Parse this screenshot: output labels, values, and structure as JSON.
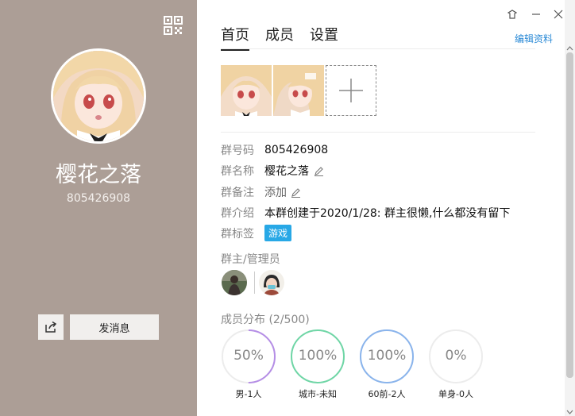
{
  "profile": {
    "name": "樱花之落",
    "id": "805426908",
    "send_label": "发消息"
  },
  "tabs": [
    {
      "label": "首页",
      "active": true
    },
    {
      "label": "成员",
      "active": false
    },
    {
      "label": "设置",
      "active": false
    }
  ],
  "edit_label": "编辑资料",
  "info": {
    "id_label": "群号码",
    "id_value": "805426908",
    "name_label": "群名称",
    "name_value": "樱花之落",
    "remark_label": "群备注",
    "remark_value": "添加",
    "intro_label": "群介绍",
    "intro_value": "本群创建于2020/1/28:  群主很懒,什么都没有留下",
    "tag_label": "群标签",
    "tag_value": "游戏"
  },
  "admins_title": "群主/管理员",
  "distribution_title": "成员分布 (2/500)",
  "stats": [
    {
      "pct": "50%",
      "value": 0.5,
      "caption": "男-1人",
      "color": "#b58ee6"
    },
    {
      "pct": "100%",
      "value": 1.0,
      "caption": "城市-未知",
      "color": "#6fd6a6"
    },
    {
      "pct": "100%",
      "value": 1.0,
      "caption": "60前-2人",
      "color": "#8ab4ec"
    },
    {
      "pct": "0%",
      "value": 0.0,
      "caption": "单身-0人",
      "color": "#cfcfcf"
    }
  ],
  "icons": {
    "qr": "qr-code-icon",
    "share": "share-icon",
    "pencil": "pencil-icon",
    "add": "plus-icon",
    "skin": "skin-icon",
    "min": "minimize-icon",
    "close": "close-icon"
  }
}
